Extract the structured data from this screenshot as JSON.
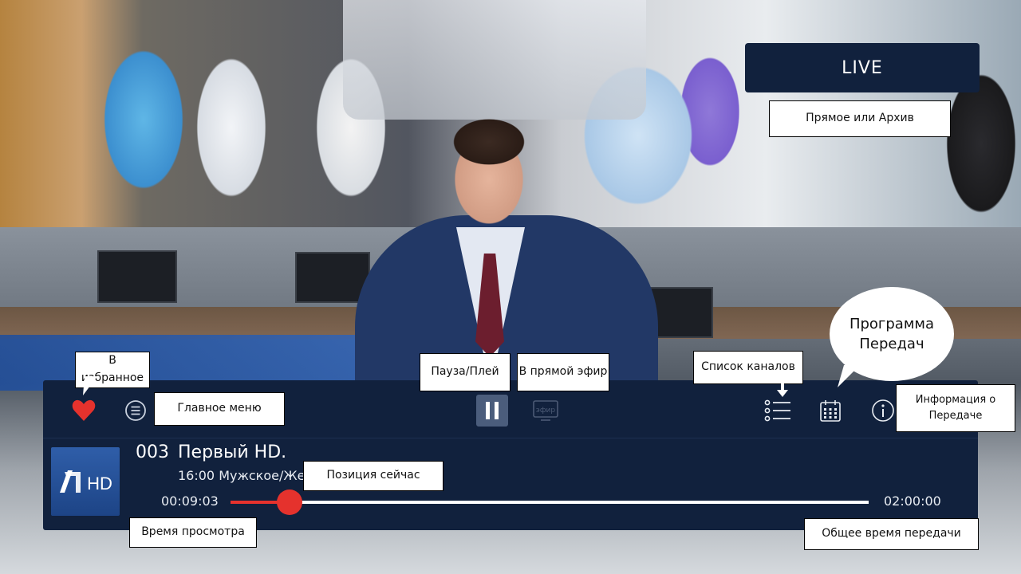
{
  "video": {
    "status_label": "LIVE"
  },
  "controls": {
    "favorite_icon": "heart-icon",
    "menu_icon": "menu-icon",
    "pause_icon": "pause-icon",
    "live_icon": "live-broadcast-icon",
    "live_icon_text": "эфир",
    "channels_icon": "channel-list-icon",
    "epg_icon": "calendar-icon",
    "info_icon": "info-icon"
  },
  "channel": {
    "number": "003",
    "name": "Первый HD.",
    "logo_text": "HD",
    "program": "16:00 Мужское/Же"
  },
  "playback": {
    "current_time": "00:09:03",
    "total_time": "02:00:00",
    "progress": 0.0925
  },
  "annotations": {
    "live_or_archive": "Прямое или Архив",
    "favorites": "В избранное",
    "main_menu": "Главное меню",
    "pause_play": "Пауза/Плей",
    "go_live": "В прямой эфир",
    "channel_list": "Список каналов",
    "program_guide_line1": "Программа",
    "program_guide_line2": "Передач",
    "program_info_line1": "Информация о",
    "program_info_line2": "Передаче",
    "current_position": "Позиция сейчас",
    "watch_time": "Время просмотра",
    "total_time": "Общее время передачи"
  },
  "colors": {
    "panel": "#11213d",
    "accent_red": "#e5322d",
    "button_active": "#4b5d7c"
  }
}
